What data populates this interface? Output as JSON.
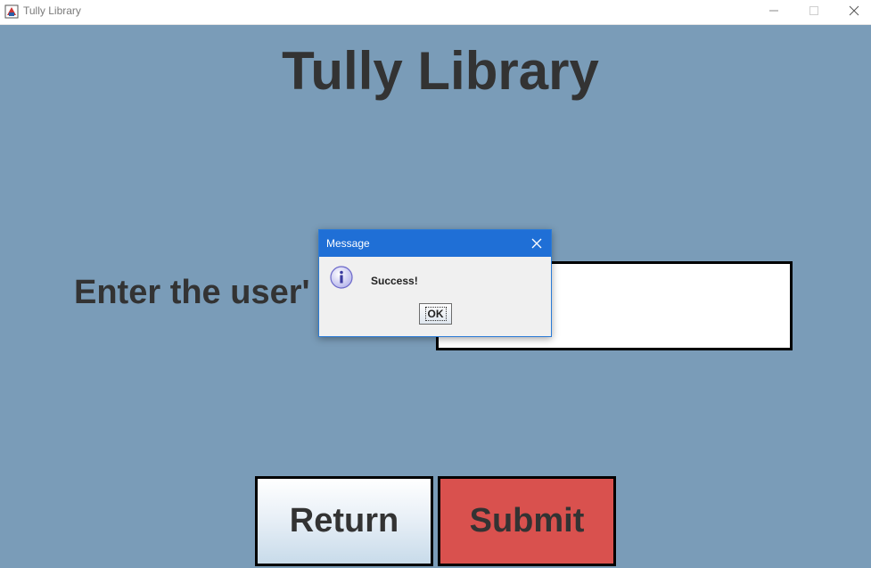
{
  "window": {
    "title": "Tully Library",
    "controls": [
      "minimize-icon",
      "maximize-icon",
      "close-icon"
    ]
  },
  "main": {
    "heading": "Tully Library",
    "prompt_label": "Enter the user'",
    "user_input_value": "",
    "buttons": {
      "return_label": "Return",
      "submit_label": "Submit"
    }
  },
  "dialog": {
    "title": "Message",
    "icon": "info-icon",
    "message": "Success!",
    "ok_label": "OK"
  },
  "colors": {
    "background": "#7a9cb8",
    "submit": "#d9514e",
    "dialog_titlebar": "#1f6fd6",
    "text": "#333333"
  }
}
